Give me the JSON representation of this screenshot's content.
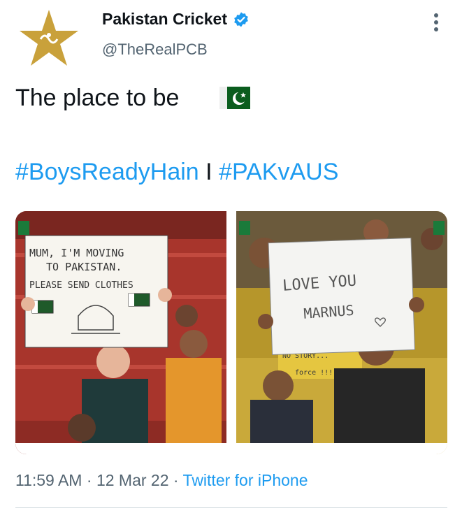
{
  "author": {
    "display_name": "Pakistan Cricket",
    "handle": "@TheRealPCB",
    "verified": true,
    "avatar_icon": "pcb-star-logo-icon"
  },
  "tweet": {
    "text": "The place to be",
    "flag_icon": "pakistan-flag-icon",
    "hashtags": [
      "#BoysReadyHain",
      "#PAKvAUS"
    ],
    "separator": "I"
  },
  "photos": {
    "left_sign": [
      "MUM, I'M MOVING",
      "TO PAKISTAN.",
      "PLEASE SEND CLOTHES"
    ],
    "right_sign": [
      "LOVE YOU",
      "MARNUS"
    ],
    "right_back_sign": [
      "NO STORY...",
      "force !!!"
    ]
  },
  "meta": {
    "time": "11:59 AM",
    "dot": "·",
    "date": "12 Mar 22",
    "source": "Twitter for iPhone"
  },
  "colors": {
    "accent": "#1d9bf0",
    "secondary_text": "#536471",
    "logo_gold": "#c9a13b",
    "stand_red": "#b8322b"
  }
}
